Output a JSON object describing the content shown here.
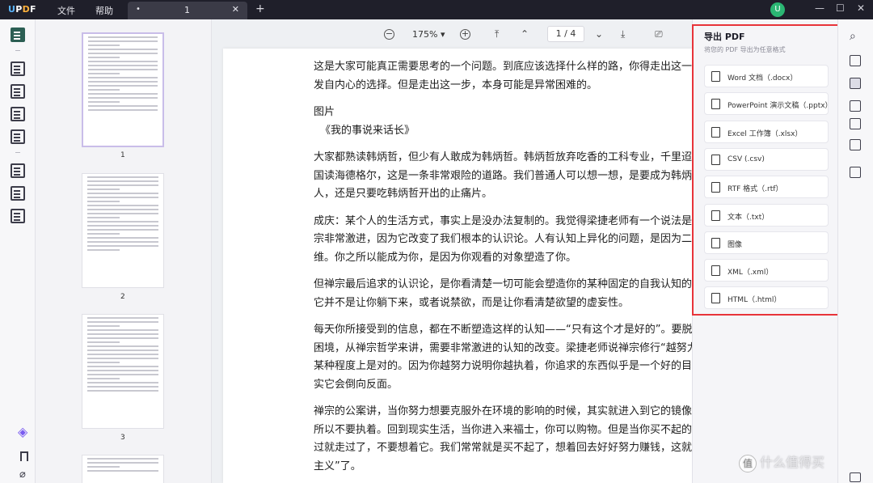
{
  "titlebar": {
    "logo": "UPDF",
    "menu": [
      "文件",
      "帮助"
    ],
    "tab_title": "1",
    "avatar_letter": "U"
  },
  "toolbar": {
    "zoom": "175%",
    "page_indicator": "1 / 4"
  },
  "thumbnails": [
    {
      "number": "1"
    },
    {
      "number": "2"
    },
    {
      "number": "3"
    }
  ],
  "document": {
    "paragraphs": [
      [
        "这是大家可能真正需要思考的一个问题。到底应该选择什么样的路，你得走出这一步",
        "发自内心的选择。但是走出这一步，本身可能是异常困难的。"
      ],
      [
        "图片",
        "《我的事说来话长》"
      ],
      [
        "大家都熟读韩炳哲，但少有人敢成为韩炳哲。韩炳哲放弃吃香的工科专业，千里迢迢",
        "国读海德格尔，这是一条非常艰险的道路。我们普通人可以想一想，是要成为韩炳哲",
        "人，还是只要吃韩炳哲开出的止痛片。"
      ],
      [
        "成庆：某个人的生活方式，事实上是没办法复制的。我觉得梁捷老师有一个说法是对",
        "宗非常激进，因为它改变了我们根本的认识论。人有认知上异化的问题，是因为二元",
        "维。你之所以能成为你，是因为你观看的对象塑造了你。"
      ],
      [
        "但禅宗最后追求的认识论，是你看清楚一切可能会塑造你的某种固定的自我认知的",
        "它并不是让你躺下来，或者说禁欲，而是让你看清楚欲望的虚妄性。"
      ],
      [
        "每天你所接受到的信息，都在不断塑造这样的认知——“只有这个才是好的”。要脱离这样的",
        "困境，从禅宗哲学来讲，需要非常激进的认知的改变。梁捷老师说禅宗修行“越努力越失败”，",
        "某种程度上是对的。因为你越努力说明你越执着，你追求的东西似乎是一个好的目标，但其",
        "实它会倒向反面。"
      ],
      [
        "禅宗的公案讲，当你努力想要克服外在环境的影响的时候，其实就进入到它的镜像的反面，",
        "所以不要执着。回到现实生活，当你进入来福士，你可以购物。但是当你买不起的时候，走",
        "过就走过了，不要想着它。我们常常就是买不起了，想着回去好好努力赚钱，这就是“优绩",
        "主义”了。"
      ]
    ]
  },
  "export_panel": {
    "title": "导出 PDF",
    "subtitle": "将您的 PDF 导出为任意格式",
    "items": [
      {
        "label": "Word 文档（.docx）",
        "icon": "word-icon"
      },
      {
        "label": "PowerPoint 演示文稿（.pptx）",
        "icon": "powerpoint-icon"
      },
      {
        "label": "Excel 工作簿（.xlsx）",
        "icon": "excel-icon"
      },
      {
        "label": "CSV (.csv)",
        "icon": "csv-icon"
      },
      {
        "label": "RTF 格式（.rtf）",
        "icon": "rtf-icon"
      },
      {
        "label": "文本（.txt）",
        "icon": "text-icon"
      },
      {
        "label": "图像",
        "icon": "image-icon"
      },
      {
        "label": "XML（.xml）",
        "icon": "xml-icon"
      },
      {
        "label": "HTML（.html）",
        "icon": "html-icon"
      }
    ]
  },
  "watermark": {
    "badge": "值",
    "text": "什么值得买"
  },
  "colors": {
    "titlebar_bg": "#1f1f2a",
    "accent_green": "#2c5f54",
    "highlight_red": "#e8343a",
    "avatar_green": "#2bb673"
  }
}
